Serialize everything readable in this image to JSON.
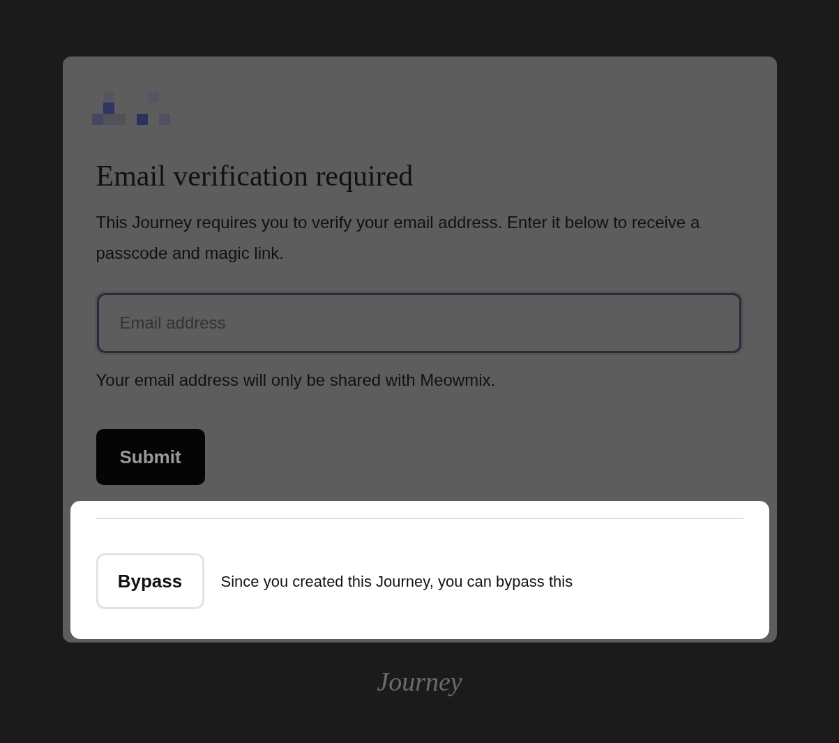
{
  "dialog": {
    "title": "Email verification required",
    "description": "This Journey requires you to verify your email address. Enter it below to receive a passcode and magic link.",
    "email_field": {
      "placeholder": "Email address"
    },
    "privacy_note": "Your email address will only be shared with Meowmix.",
    "submit_button": "Submit"
  },
  "bypass_panel": {
    "button": "Bypass",
    "note": "Since you created this Journey, you can bypass this"
  },
  "footer": {
    "wordmark": "Journey"
  }
}
